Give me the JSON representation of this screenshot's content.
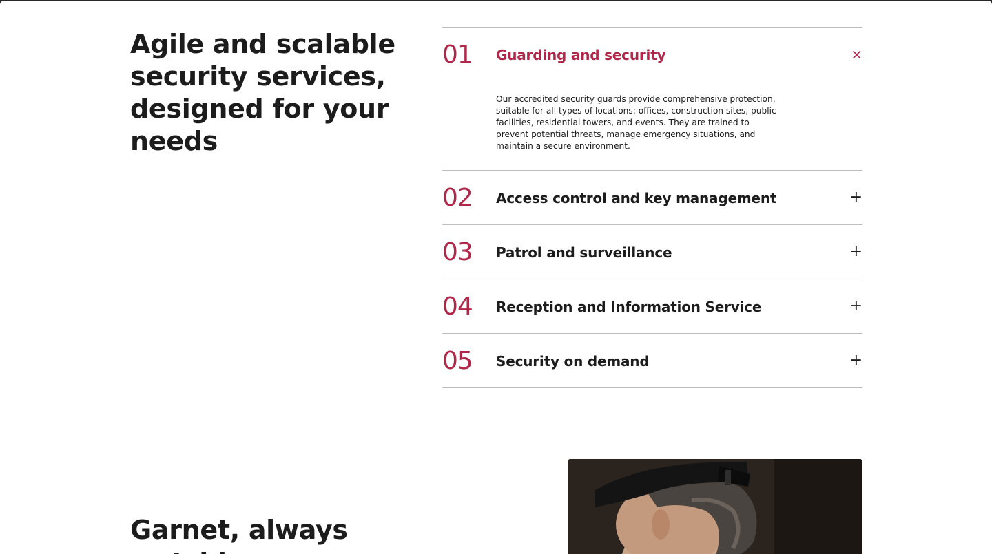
{
  "headline": "Agile and scalable security services, designed for your needs",
  "accordion": {
    "items": [
      {
        "number": "01",
        "title": "Guarding and security",
        "open": true,
        "toggle": "×",
        "body": "Our accredited security guards provide comprehensive protection, suitable for all types of locations: offices, construction sites, public facilities, residential towers, and events. They are trained to prevent potential threats, manage emergency situations, and maintain a secure environment."
      },
      {
        "number": "02",
        "title": "Access control and key management",
        "open": false,
        "toggle": "+"
      },
      {
        "number": "03",
        "title": "Patrol and surveillance",
        "open": false,
        "toggle": "+"
      },
      {
        "number": "04",
        "title": "Reception and Information Service",
        "open": false,
        "toggle": "+"
      },
      {
        "number": "05",
        "title": "Security on demand",
        "open": false,
        "toggle": "+"
      }
    ]
  },
  "subhead": "Garnet, always watching",
  "colors": {
    "accent": "#b0274a",
    "text": "#1c1c1c",
    "divider": "#bdbdbd"
  },
  "photo": {
    "icon": "security-guard-photo"
  }
}
